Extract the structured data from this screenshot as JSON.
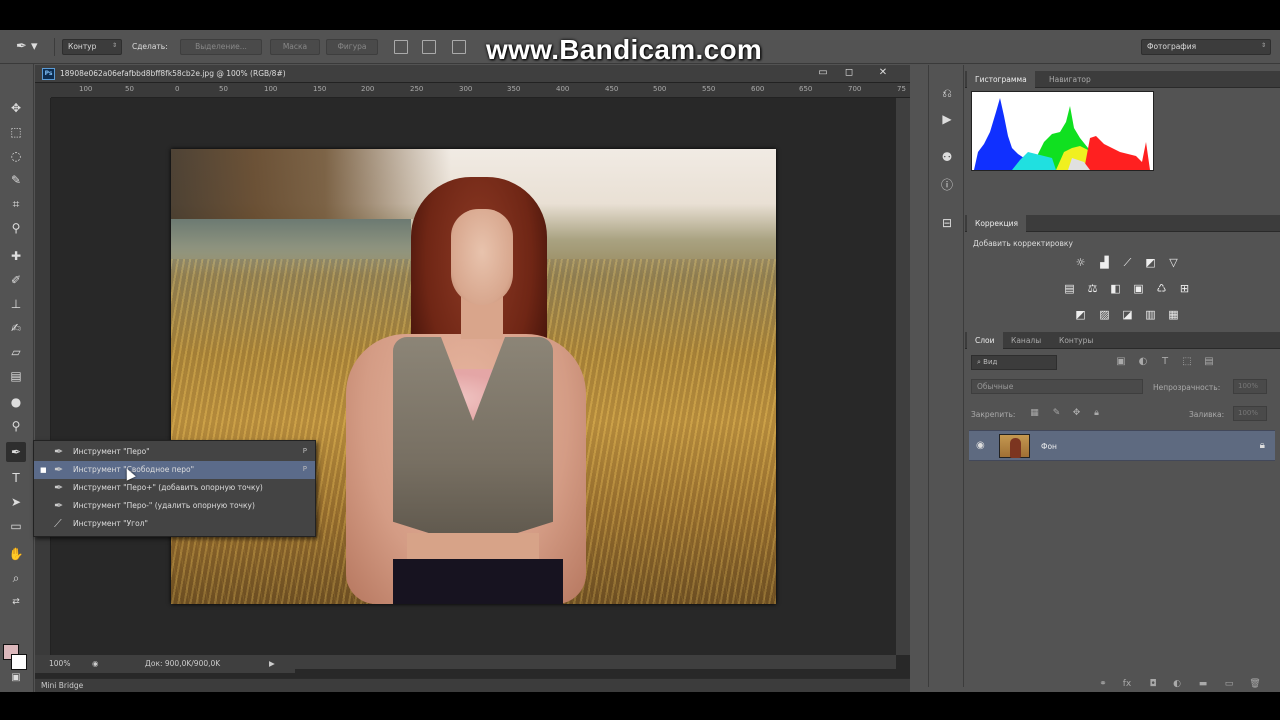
{
  "watermark": "www.Bandicam.com",
  "options_bar": {
    "mode_value": "Контур",
    "make_label": "Сделать:",
    "selection_button": "Выделение...",
    "mask_button": "Маска",
    "shape_button": "Фигура",
    "workspace_value": "Фотография"
  },
  "document": {
    "tab_title": "18908e062a06efafbbd8bff8fk58cb2e.jpg @ 100% (RGB/8#)",
    "ruler_ticks": [
      "100",
      "50",
      "0",
      "50",
      "100",
      "150",
      "200",
      "250",
      "300",
      "350",
      "400",
      "450",
      "500",
      "550",
      "600",
      "650",
      "700",
      "75"
    ],
    "zoom": "100%",
    "doc_size": "Док: 900,0K/900,0K"
  },
  "flyout": {
    "items": [
      {
        "label": "Инструмент \"Перо\"",
        "key": "P",
        "selected": false
      },
      {
        "label": "Инструмент \"Свободное перо\"",
        "key": "P",
        "selected": true
      },
      {
        "label": "Инструмент \"Перо+\" (добавить опорную точку)",
        "key": "",
        "selected": false
      },
      {
        "label": "Инструмент \"Перо-\" (удалить опорную точку)",
        "key": "",
        "selected": false
      },
      {
        "label": "Инструмент \"Угол\"",
        "key": "",
        "selected": false
      }
    ]
  },
  "panels": {
    "histogram_tab": "Гистограмма",
    "navigator_tab": "Навигатор",
    "adjustments_tab": "Коррекция",
    "adjustments_title": "Добавить корректировку",
    "layers_tab": "Слои",
    "channels_tab": "Каналы",
    "paths_tab": "Контуры",
    "layer_filter": "Вид",
    "blend_mode": "Обычные",
    "opacity_label": "Непрозрачность:",
    "opacity_value": "100%",
    "lock_label": "Закрепить:",
    "fill_label": "Заливка:",
    "fill_value": "100%",
    "layer_name": "Фон"
  },
  "mini_bridge": "Mini Bridge",
  "colors": {
    "foreground": "#dcb8bc",
    "background": "#ffffff",
    "ui_panel": "#535353",
    "highlight": "#5b6b8a"
  },
  "icons": {
    "toolbar": [
      "move-icon",
      "marquee-icon",
      "lasso-icon",
      "quick-selection-icon",
      "crop-icon",
      "eyedropper-icon",
      "healing-icon",
      "brush-icon",
      "stamp-icon",
      "history-brush-icon",
      "eraser-icon",
      "gradient-icon",
      "blur-icon",
      "dodge-icon",
      "pen-icon",
      "type-icon",
      "path-selection-icon",
      "rectangle-icon",
      "hand-icon",
      "zoom-icon"
    ]
  }
}
